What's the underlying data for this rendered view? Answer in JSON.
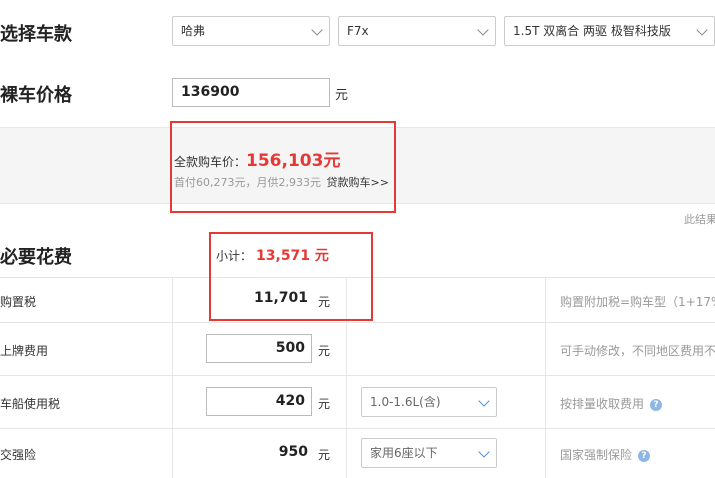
{
  "select_car": {
    "title": "选择车款",
    "brand": "哈弗",
    "model": "F7x",
    "version": "1.5T 双离合 两驱 极智科技版"
  },
  "bare_price": {
    "title": "裸车价格",
    "value": "136900",
    "unit": "元"
  },
  "full_price": {
    "label": "全款购车价：",
    "value": "156,103元",
    "detail": "首付60,273元，月供2,933元",
    "loan_link": "贷款购车>>"
  },
  "result_note": "此结果",
  "required_fees": {
    "title": "必要花费",
    "subtotal_label": "小计：",
    "subtotal_value": "13,571 元",
    "rows": [
      {
        "label": "购置税",
        "value": "11,701",
        "unit": "元",
        "note": "购置附加税=购车型（1+17%"
      },
      {
        "label": "上牌费用",
        "value": "500",
        "unit": "元",
        "note": "可手动修改，不同地区费用不"
      },
      {
        "label": "车船使用税",
        "value": "420",
        "unit": "元",
        "option": "1.0-1.6L(含)",
        "note": "按排量收取费用"
      },
      {
        "label": "交强险",
        "value": "950",
        "unit": "元",
        "option": "家用6座以下",
        "note": "国家强制保险"
      }
    ]
  },
  "colors": {
    "accent_red": "#e53935",
    "help_blue": "#8fb7e6"
  }
}
